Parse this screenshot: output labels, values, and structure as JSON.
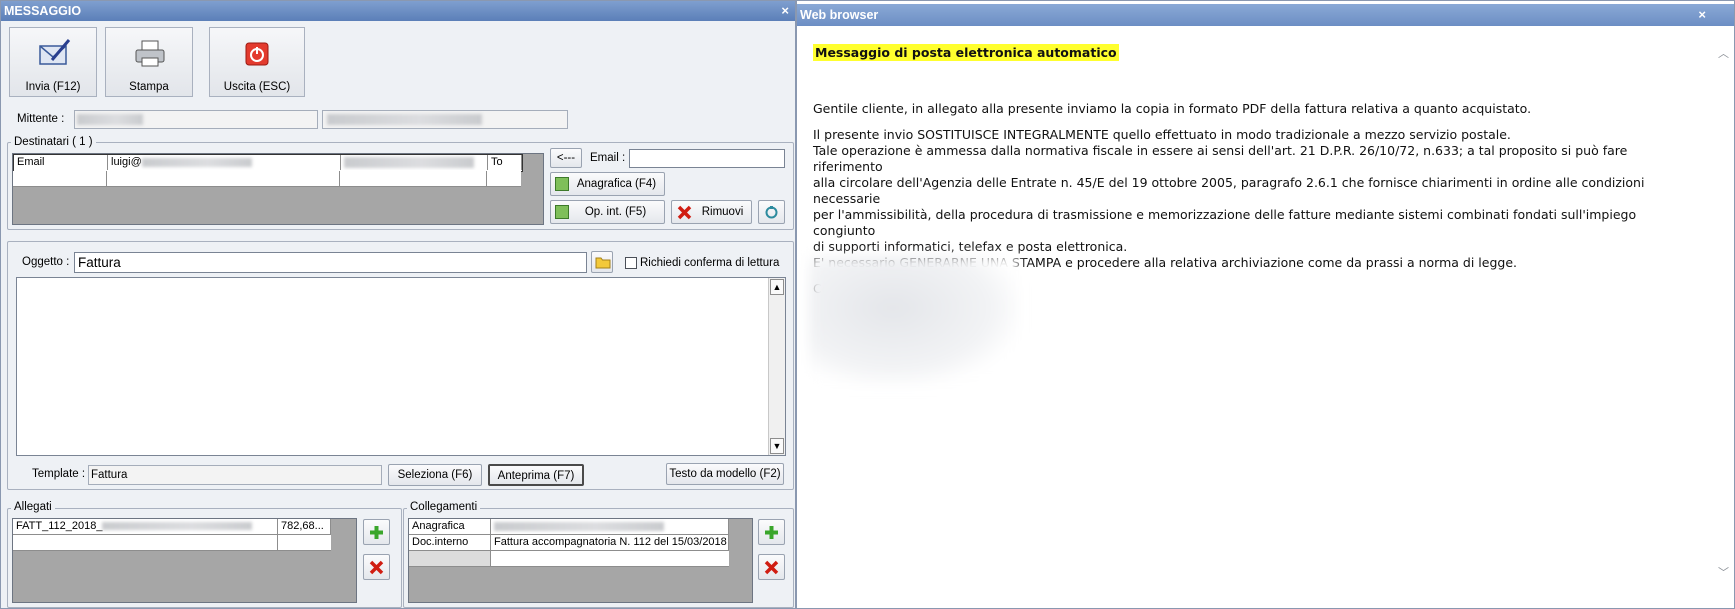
{
  "message_window": {
    "title": "MESSAGGIO",
    "close_glyph": "×",
    "toolbar": {
      "send_label": "Invia (F12)",
      "print_label": "Stampa",
      "exit_label": "Uscita (ESC)"
    },
    "sender_label": "Mittente :",
    "recipients": {
      "group_label": "Destinatari ( 1 )",
      "rows": [
        {
          "type": "Email",
          "address": "luigi@",
          "name": "",
          "kind": "To"
        }
      ],
      "arrow_button": "<---",
      "email_label": "Email :",
      "email_value": "",
      "anagrafica_button": "Anagrafica (F4)",
      "opint_button": "Op. int. (F5)",
      "remove_button": "Rimuovi"
    },
    "subject": {
      "label": "Oggetto :",
      "value": "Fattura",
      "read_receipt_label": "Richiedi conferma di lettura",
      "read_receipt_checked": false
    },
    "template": {
      "label": "Template :",
      "value": "Fattura",
      "select_button": "Seleziona (F6)",
      "preview_button": "Anteprima (F7)",
      "from_model_button": "Testo da modello (F2)"
    },
    "attachments": {
      "group_label": "Allegati",
      "rows": [
        {
          "name": "FATT_112_2018_",
          "size": "782,68..."
        }
      ]
    },
    "links": {
      "group_label": "Collegamenti",
      "rows": [
        {
          "type": "Anagrafica",
          "value": ""
        },
        {
          "type": "Doc.interno",
          "value": "Fattura accompagnatoria N. 112 del 15/03/2018"
        }
      ]
    }
  },
  "browser_window": {
    "title": "Web browser",
    "close_glyph": "×",
    "heading": "Messaggio di posta elettronica automatico",
    "paragraph1": "Gentile cliente, in allegato alla presente inviamo la copia in formato PDF della fattura relativa a quanto acquistato.",
    "paragraph2_lines": [
      "Il presente invio SOSTITUISCE INTEGRALMENTE quello effettuato in modo tradizionale a mezzo servizio postale.",
      "Tale operazione è ammessa dalla normativa fiscale in essere ai sensi dell'art. 21 D.P.R. 26/10/72, n.633; a tal proposito si può fare riferimento",
      "alla circolare dell'Agenzia delle Entrate n. 45/E del 19 ottobre 2005, paragrafo 2.6.1 che fornisce chiarimenti in ordine alle condizioni necessarie",
      "per l'ammissibilità, della procedura di trasmissione e memorizzazione delle fatture mediante sistemi combinati fondati sull'impiego congiunto",
      "di supporti informatici, telefax e posta elettronica.",
      "E' necessario GENERARNE UNA STAMPA e procedere alla relativa archiviazione come da prassi a norma di legge."
    ],
    "closing": "Cordiali Saluti"
  },
  "colors": {
    "titlebar": "#5b7fb8",
    "highlight": "#ffff2e",
    "grid_background": "#a6a6a6"
  }
}
